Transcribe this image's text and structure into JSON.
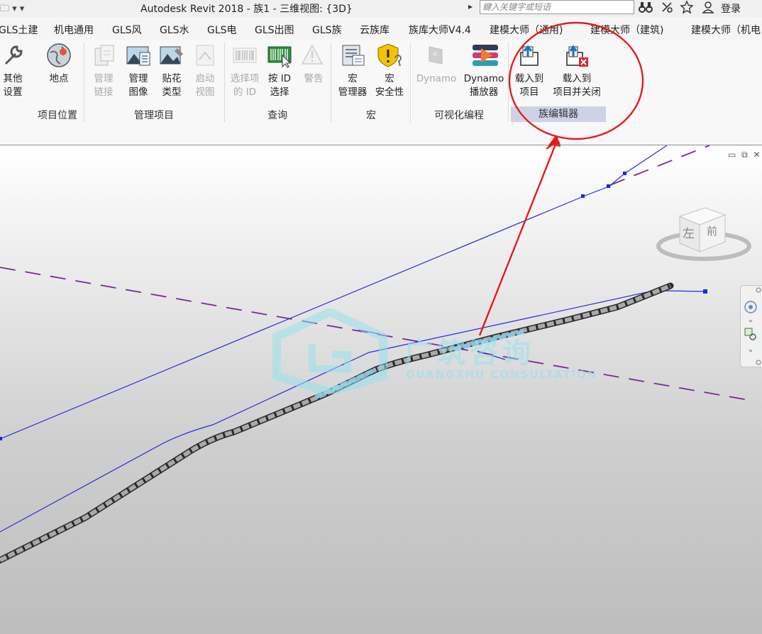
{
  "titlebar": {
    "qat": "🗀 ▾ ▾",
    "title": "Autodesk Revit 2018 -    族1 - 三维视图: {3D}",
    "search_arrow": "▸",
    "search_placeholder": "鍵入关键字或短语",
    "login": "登录",
    "icons": [
      "binoculars-icon",
      "connect-icon",
      "star-icon",
      "user-icon"
    ]
  },
  "tabs": [
    "GLS土建",
    "机电通用",
    "GLS风",
    "GLS水",
    "GLS电",
    "GLS出图",
    "GLS族",
    "云族库",
    "族库大师V4.4",
    "建模大师（通用)",
    "建模大师（建筑)",
    "建模大师（机电"
  ],
  "ribbon": {
    "tools": [
      {
        "label": "其他\n设置",
        "enabled": true,
        "icon": "wrench-icon"
      },
      {
        "label": "地点",
        "enabled": true,
        "icon": "globe-icon"
      },
      {
        "label": "管理\n链接",
        "enabled": false,
        "icon": "manage-links-icon"
      },
      {
        "label": "管理\n图像",
        "enabled": true,
        "icon": "manage-images-icon"
      },
      {
        "label": "贴花\n类型",
        "enabled": true,
        "icon": "decal-types-icon"
      },
      {
        "label": "启动\n视图",
        "enabled": false,
        "icon": "starting-view-icon"
      },
      {
        "label": "选择项\n的 ID",
        "enabled": false,
        "icon": "barcode-icon"
      },
      {
        "label": "按 ID\n选择",
        "enabled": true,
        "icon": "select-by-id-icon"
      },
      {
        "label": "警告",
        "enabled": false,
        "icon": "warning-icon"
      },
      {
        "label": "宏\n管理器",
        "enabled": true,
        "icon": "macro-manager-icon"
      },
      {
        "label": "宏\n安全性",
        "enabled": true,
        "icon": "macro-security-icon"
      },
      {
        "label": "Dynamo",
        "enabled": false,
        "icon": "dynamo-icon"
      },
      {
        "label": "Dynamo\n播放器",
        "enabled": true,
        "icon": "dynamo-player-icon"
      },
      {
        "label": "载入到\n项目",
        "enabled": true,
        "icon": "load-into-project-icon"
      },
      {
        "label": "载入到\n项目并关闭",
        "enabled": true,
        "icon": "load-and-close-icon"
      }
    ],
    "panels": [
      "项目位置",
      "管理项目",
      "查询",
      "宏",
      "可视化编程",
      "族编辑器"
    ]
  },
  "viewport": {
    "window_controls": "▭ ⧉ ✕",
    "watermark_name": "广筑咨询",
    "watermark_sub": "GUANGZHU CONSULTATION",
    "viewcube_left": "左",
    "viewcube_front": "前"
  },
  "colors": {
    "annotation_red": "#e41c1c",
    "line_blue": "#2b2bd8",
    "dashed_purple": "#7a2a98",
    "panel_highlight": "#cfd2e6"
  }
}
